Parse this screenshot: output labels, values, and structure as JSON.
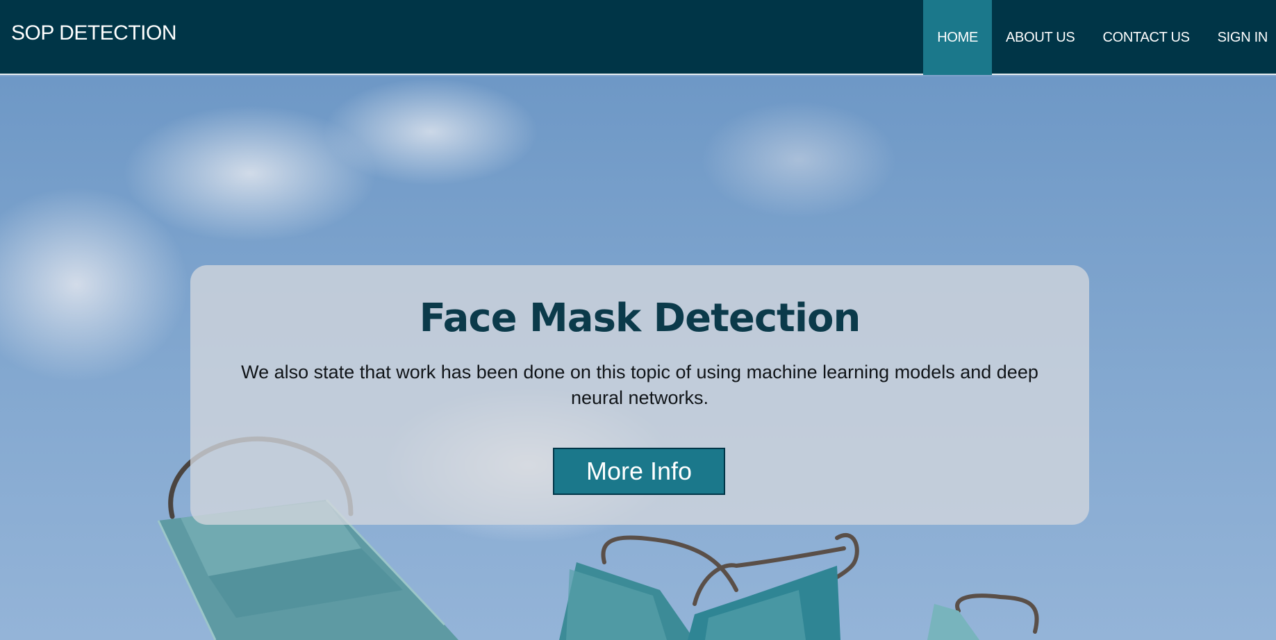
{
  "header": {
    "brand": "SOP DETECTION",
    "nav": [
      {
        "label": "HOME",
        "active": true
      },
      {
        "label": "ABOUT US",
        "active": false
      },
      {
        "label": "CONTACT US",
        "active": false
      },
      {
        "label": "SIGN IN",
        "active": false
      }
    ]
  },
  "hero": {
    "background_image": "surgical-face-masks-against-blue-sky",
    "title": "Face Mask Detection",
    "description": "We also state that work has been done on this topic of using machine learning models and deep neural networks.",
    "button_label": "More Info"
  },
  "colors": {
    "navbar": "#003547",
    "accent": "#1b788b",
    "title": "#0b3a4a"
  }
}
